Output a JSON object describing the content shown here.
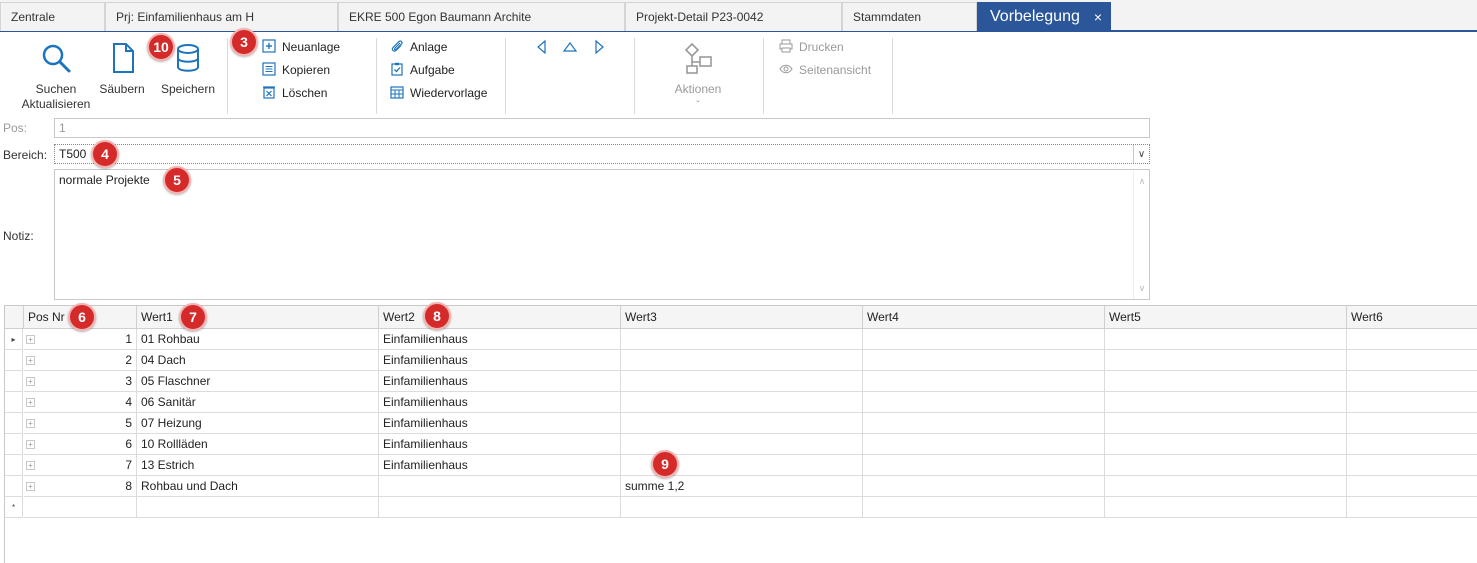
{
  "tabs": [
    {
      "label": "Zentrale"
    },
    {
      "label": "Prj: Einfamilienhaus am H"
    },
    {
      "label": "EKRE 500 Egon Baumann Archite"
    },
    {
      "label": "Projekt-Detail P23-0042"
    },
    {
      "label": "Stammdaten"
    },
    {
      "label": "Vorbelegung",
      "close": "×"
    }
  ],
  "ribbon": {
    "suchen": "Suchen\nAktualisieren",
    "saeubern": "Säubern",
    "speichern": "Speichern",
    "neuanlage": "Neuanlage",
    "kopieren": "Kopieren",
    "loeschen": "Löschen",
    "anlage": "Anlage",
    "aufgabe": "Aufgabe",
    "wiedervorlage": "Wiedervorlage",
    "aktionen": "Aktionen",
    "aktionen_arrow": "ˇ",
    "drucken": "Drucken",
    "seitenansicht": "Seitenansicht"
  },
  "form": {
    "pos_label": "Pos:",
    "pos_value": "1",
    "bereich_label": "Bereich:",
    "bereich_value": "T500",
    "notiz_label": "Notiz:",
    "notiz_value": "normale Projekte"
  },
  "grid": {
    "columns": [
      "Pos Nr",
      "Wert1",
      "Wert2",
      "Wert3",
      "Wert4",
      "Wert5",
      "Wert6"
    ],
    "rows": [
      [
        "1",
        "01 Rohbau",
        "Einfamilienhaus",
        "",
        "",
        "",
        ""
      ],
      [
        "2",
        "04 Dach",
        "Einfamilienhaus",
        "",
        "",
        "",
        ""
      ],
      [
        "3",
        "05 Flaschner",
        "Einfamilienhaus",
        "",
        "",
        "",
        ""
      ],
      [
        "4",
        "06 Sanitär",
        "Einfamilienhaus",
        "",
        "",
        "",
        ""
      ],
      [
        "5",
        "07 Heizung",
        "Einfamilienhaus",
        "",
        "",
        "",
        ""
      ],
      [
        "6",
        "10 Rollläden",
        "Einfamilienhaus",
        "",
        "",
        "",
        ""
      ],
      [
        "7",
        "13 Estrich",
        "Einfamilienhaus",
        "",
        "",
        "",
        ""
      ],
      [
        "8",
        "Rohbau und Dach",
        "",
        "summe 1,2",
        "",
        "",
        ""
      ]
    ],
    "current_row_marker": "▸",
    "new_row_marker": "*",
    "expand_symbol": "+"
  },
  "markers": [
    "10",
    "3",
    "4",
    "5",
    "6",
    "7",
    "8",
    "9"
  ],
  "colors": {
    "accent": "#2b579a",
    "icon_blue": "#1e73be",
    "marker_red": "#d42a2a"
  }
}
